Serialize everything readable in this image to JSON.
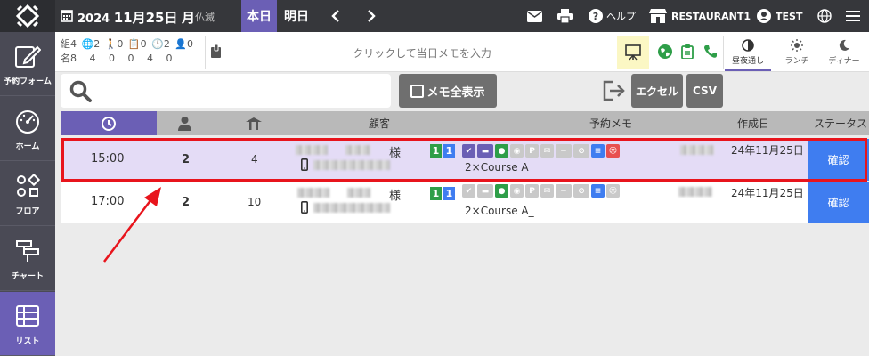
{
  "header": {
    "year": "2024",
    "date": "11月25日",
    "weekday": "月",
    "rokuyo": "仏滅",
    "today_label": "本日",
    "tomorrow_label": "明日",
    "help_label": "ヘルプ",
    "restaurant_label": "RESTAURANT1",
    "user_label": "TEST"
  },
  "sidebar": {
    "items": [
      {
        "label": "予約フォーム",
        "icon": "edit-icon"
      },
      {
        "label": "ホーム",
        "icon": "dashboard-icon"
      },
      {
        "label": "フロア",
        "icon": "floor-icon"
      },
      {
        "label": "チャート",
        "icon": "chart-icon"
      },
      {
        "label": "リスト",
        "icon": "list-icon"
      }
    ]
  },
  "stats": {
    "row1": [
      "組4",
      "2",
      "0",
      "0",
      "2",
      "0"
    ],
    "row2": [
      "名8",
      "4",
      "0",
      "0",
      "4",
      "0"
    ]
  },
  "memo_placeholder": "クリックして当日メモを入力",
  "periods": [
    {
      "label": "昼夜通し",
      "active": true
    },
    {
      "label": "ランチ",
      "active": false
    },
    {
      "label": "ディナー",
      "active": false
    }
  ],
  "toolbar": {
    "memo_all_label": "メモ全表示",
    "excel_label": "エクセル",
    "csv_label": "CSV"
  },
  "table": {
    "headers": {
      "customer": "顧客",
      "memo": "予約メモ",
      "created": "作成日",
      "status": "ステータス"
    },
    "rows": [
      {
        "time": "15:00",
        "people": "2",
        "table": "4",
        "honorific": "様",
        "badges": [
          "1",
          "1"
        ],
        "course": "2×Course A",
        "created": "24年11月25日",
        "status": "確認"
      },
      {
        "time": "17:00",
        "people": "2",
        "table": "10",
        "honorific": "様",
        "badges": [
          "1",
          "1"
        ],
        "course": "2×Course A_",
        "created": "24年11月25日",
        "status": "確認"
      }
    ]
  },
  "colors": {
    "accent": "#6b5fb5",
    "topbar": "#36373b",
    "confirm": "#3f7df0",
    "highlight": "#e8141c"
  }
}
